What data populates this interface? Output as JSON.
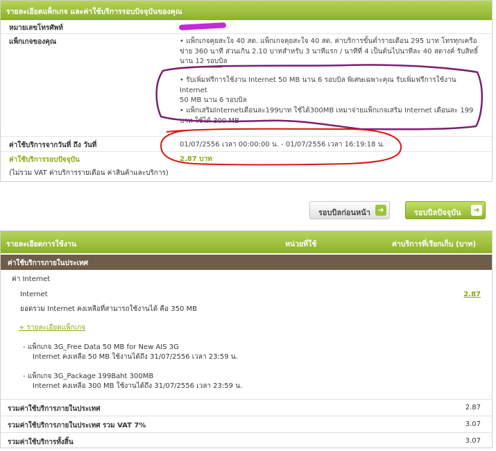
{
  "package_panel": {
    "header": "รายละเอียดแพ็กเกจ และค่าใช้บริการรอบปัจจุบันของคุณ",
    "phone_label": "หมายเลขโทรศัพท์",
    "package_label": "แพ็กเกจของคุณ",
    "package_lines": [
      "แพ็กเกจคุยสะใจ 40 สต. แพ็กเกจคุยสะใจ 40 สต. ค่าบริการขั้นต่ำรายเดือน 295 บาท โทรทุกเครือ",
      "ข่าย 360 นาที ส่วนเกิน 2.10 บาทสำหรับ 3 นาทีแรก / นาทีที่ 4 เป็นต้นไปนาทีละ 40 สตางค์ รับสิทธิ์",
      "นาน 12 รอบบิล"
    ],
    "promo1_lines": [
      "รับเพิ่มฟรีการใช้งาน Internet 50 MB นาน 6 รอบบิล พิเศษเฉพาะคุณ รับเพิ่มฟรีการใช้งาน Internet",
      "50 MB นาน 6 รอบบิล"
    ],
    "promo2_lines": [
      "แพ็กเสริมInternetเดือนละ199บาท ใช้ได้300MB เหมาจ่ายแพ็กเกจเสริม Internet เดือนละ 199",
      "บาท ใช้ได้ 300 MB"
    ],
    "period_label": "ค่าใช้บริการจากวันที่ ถึง วันที่",
    "period_value": "01/07/2556 เวลา 00:00:00 น. - 01/07/2556 เวลา 16:19:18 น.",
    "current_charge_label": "ค่าใช้บริการรอบปัจจุบัน",
    "current_charge_value": "2.87 บาท",
    "vat_note": "(ไม่รวม VAT ค่าบริการรายเดือน ค่าสินค้าและบริการ)"
  },
  "buttons": {
    "prev_bill": "รอบบิลก่อนหน้า",
    "current_bill": "รอบบิลปัจจุบัน"
  },
  "usage_panel": {
    "headers": {
      "detail": "รายละเอียดการใช้งาน",
      "unit": "หน่วยที่ใช้",
      "charge": "ค่าบริการที่เรียกเก็บ (บาท)"
    },
    "domestic_title": "ค่าใช้บริการภายในประเทศ",
    "internet_section": "ค่า Internet",
    "internet_item": "Internet",
    "internet_value": "2.87",
    "remaining_total": "ยอดรวม Internet คงเหลือที่สามารถใช้งานได้ คือ 350 MB",
    "package_detail_link": "+ รายละเอียดแพ็กเกจ",
    "packages": [
      {
        "name": "- แพ็กเกจ 3G_Free Data 50 MB for New AIS 3G",
        "remaining": "Internet คงเหลือ 50 MB ใช้งานได้ถึง 31/07/2556 เวลา 23:59 น."
      },
      {
        "name": "- แพ็กเกจ 3G_Package 199Baht 300MB",
        "remaining": "Internet คงเหลือ 300 MB ใช้งานได้ถึง 31/07/2556 เวลา 23:59 น."
      }
    ],
    "summary": [
      {
        "label": "รวมค่าใช้บริการภายในประเทศ",
        "value": "2.87"
      },
      {
        "label": "รวมค่าใช้บริการภายในประเทศ รวม VAT 7%",
        "value": "3.07"
      },
      {
        "label": "รวมค่าใช้บริการทั้งสิ้น",
        "value": "3.07"
      }
    ]
  },
  "colors": {
    "header_green": "#8bb02a",
    "accent_green": "#8aa912",
    "domestic_bar": "#6e5d48",
    "annotation_purple": "#7a1f6e",
    "annotation_red": "#e01010",
    "redaction_magenta": "#c22bd8"
  }
}
